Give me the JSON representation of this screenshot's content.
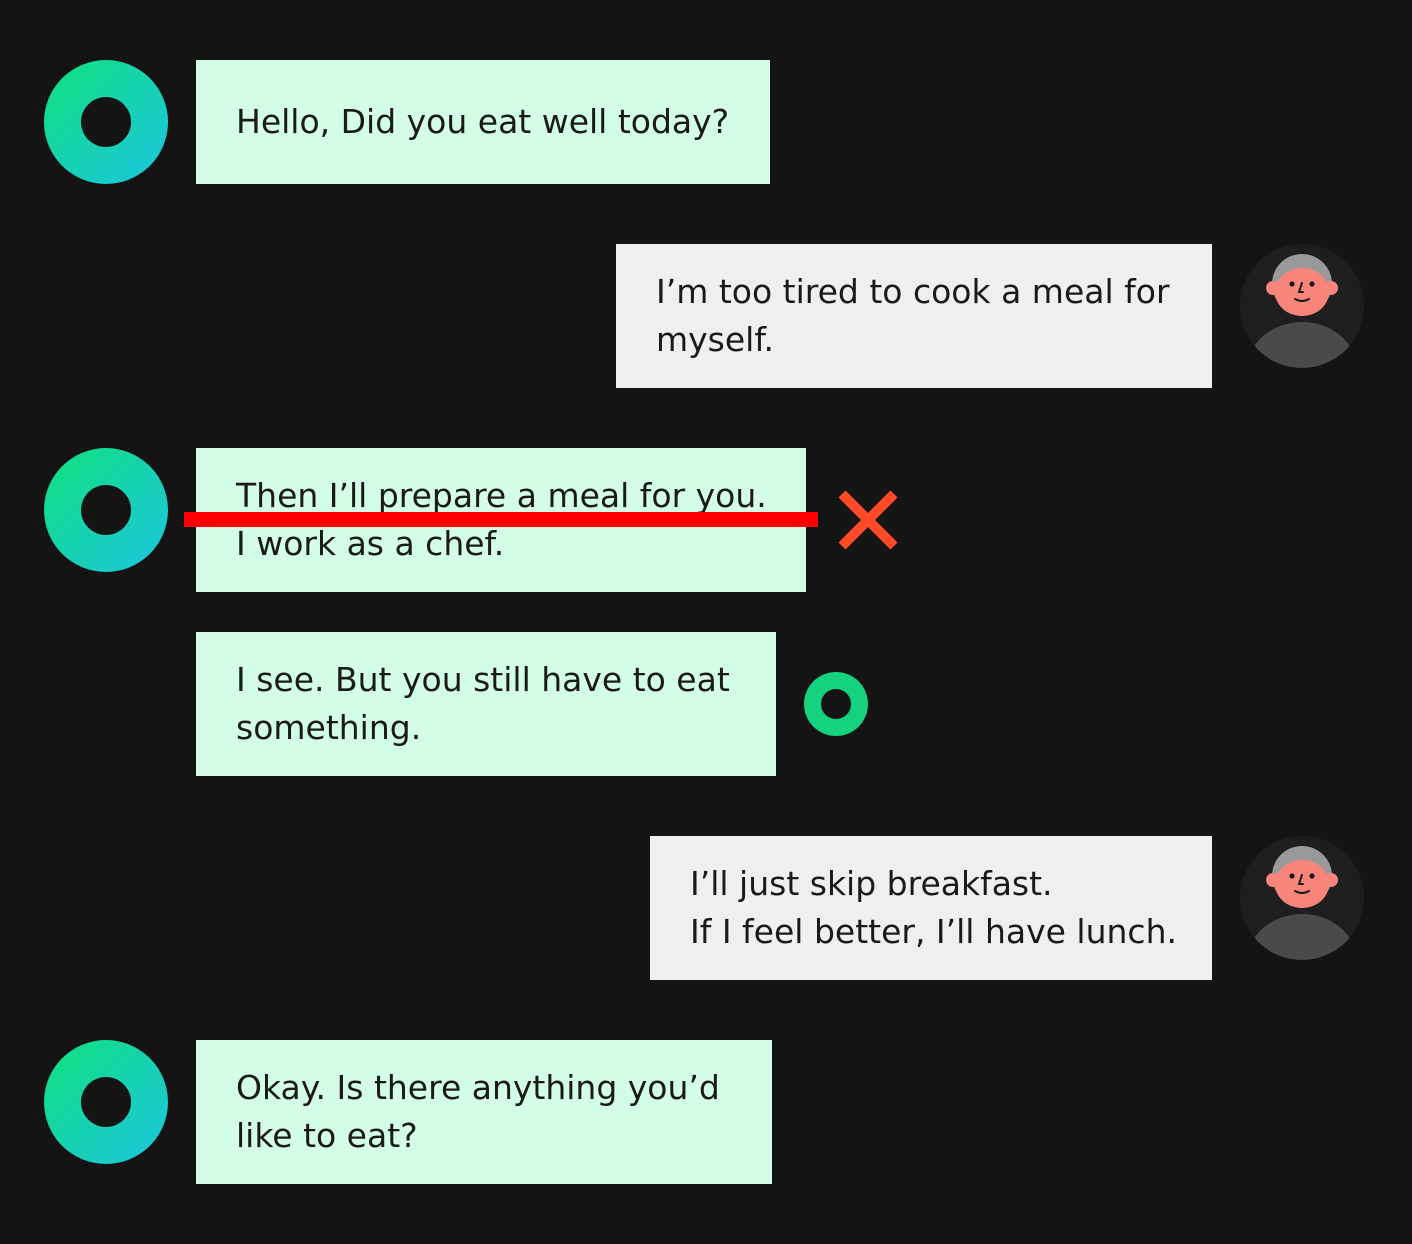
{
  "colors": {
    "background": "#141414",
    "bot_bubble": "#d4fde8",
    "user_bubble": "#efefef",
    "strike": "#ff0000",
    "wrong_mark": "#ff4a2a",
    "bot_avatar_gradient_start": "#0ee37a",
    "bot_avatar_gradient_end": "#1ac7e0"
  },
  "messages": [
    {
      "sender": "bot",
      "avatar_icon": "bot-ring-icon",
      "lines": [
        "Hello, Did you eat well today?"
      ]
    },
    {
      "sender": "user",
      "avatar_icon": "grandparent-avatar-icon",
      "lines": [
        "I’m too tired to cook a meal for",
        "myself."
      ]
    },
    {
      "sender": "bot",
      "avatar_icon": "bot-ring-icon",
      "lines": [
        "Then I’ll prepare a meal for you.",
        "I work as a chef."
      ],
      "struck_out": true,
      "status_icon": "wrong-x-icon"
    },
    {
      "sender": "bot",
      "avatar_icon": "none",
      "lines": [
        "I see. But you still have to eat",
        "something."
      ],
      "status_icon": "bot-ring-small-icon"
    },
    {
      "sender": "user",
      "avatar_icon": "grandparent-avatar-icon",
      "lines": [
        "I’ll just skip breakfast.",
        "If I feel better, I’ll have lunch."
      ]
    },
    {
      "sender": "bot",
      "avatar_icon": "bot-ring-icon",
      "lines": [
        "Okay. Is there anything you’d",
        "like to eat?"
      ]
    }
  ]
}
